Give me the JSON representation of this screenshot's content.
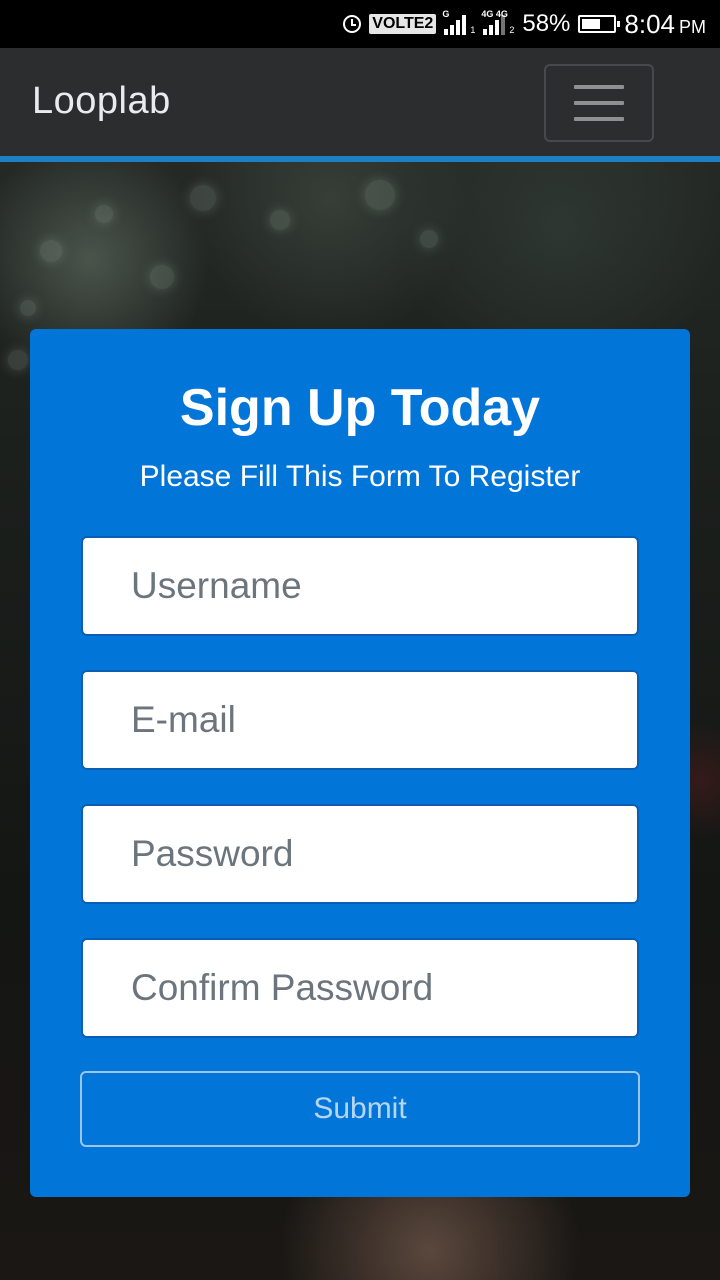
{
  "status_bar": {
    "network_badge": "VOLTE2",
    "sim1_tag": "G",
    "sim1_slot": "1",
    "sim2_tag": "4G 4G",
    "sim2_slot": "2",
    "battery_percent": "58%",
    "battery_level": 0.58,
    "time": "8:04",
    "ampm": "PM",
    "icons": [
      "alarm-icon",
      "signal-icon",
      "battery-icon"
    ]
  },
  "navbar": {
    "brand": "Looplab",
    "menu_icon": "hamburger-icon",
    "accent_color": "#1f7fc4"
  },
  "signup": {
    "title": "Sign Up Today",
    "subtitle": "Please Fill This Form To Register",
    "fields": {
      "username": {
        "placeholder": "Username",
        "value": ""
      },
      "email": {
        "placeholder": "E-mail",
        "value": ""
      },
      "password": {
        "placeholder": "Password",
        "value": ""
      },
      "confirm_password": {
        "placeholder": "Confirm Password",
        "value": ""
      }
    },
    "submit_label": "Submit",
    "card_color": "#0275d8"
  }
}
